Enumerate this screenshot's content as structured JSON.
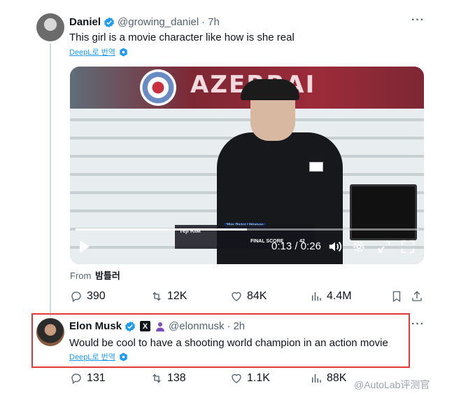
{
  "tweet1": {
    "name": "Daniel",
    "handle": "@growing_daniel",
    "time": "7h",
    "text": "This girl is a movie character like how is she real",
    "translate": "DeepL로 번역",
    "video": {
      "banner": "AZERBAI",
      "current_time": "0:13",
      "duration": "0:26",
      "progress": 0.5,
      "score_label": "25m Pistol / Women",
      "athlete": "Yeji KIM",
      "country": "KOR",
      "final_score_label": "FINAL SCORE",
      "final_score": "42"
    },
    "from_label": "From",
    "from_source": "밤틀러",
    "stats": {
      "replies": "390",
      "reposts": "12K",
      "likes": "84K",
      "views": "4.4M"
    }
  },
  "tweet2": {
    "name": "Elon Musk",
    "handle": "@elonmusk",
    "time": "2h",
    "text": "Would be cool to have a shooting world champion in an action movie",
    "translate": "DeepL로 번역",
    "x_badge": "X",
    "stats": {
      "replies": "131",
      "reposts": "138",
      "likes": "1.1K",
      "views": "88K"
    }
  },
  "more_label": "···",
  "dot": "·",
  "watermark": "@AutoLab评测官",
  "colors": {
    "verified": "#1d9bf0",
    "highlight": "#e23a3a",
    "link": "#1d9bf0",
    "muted": "#536471"
  }
}
